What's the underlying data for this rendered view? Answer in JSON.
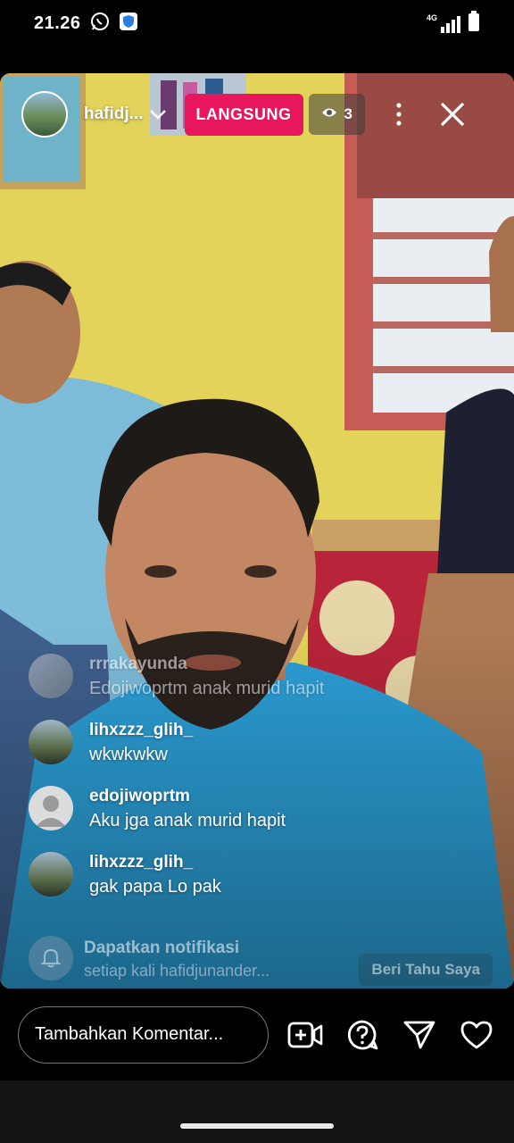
{
  "status_bar": {
    "time": "21.26",
    "network": "4G"
  },
  "live": {
    "username": "hafidj...",
    "live_label": "LANGSUNG",
    "viewer_count": "3"
  },
  "comments": [
    {
      "user": "rrrakayunda",
      "text": "Edojiwoprtm anak murid hapit"
    },
    {
      "user": "lihxzzz_glih_",
      "text": "wkwkwkw"
    },
    {
      "user": "edojiwoprtm",
      "text": "Aku jga anak murid hapit"
    },
    {
      "user": "lihxzzz_glih_",
      "text": "gak papa Lo pak"
    }
  ],
  "notification": {
    "title": "Dapatkan notifikasi",
    "subtitle": "setiap kali hafidjunander...",
    "button": "Beri Tahu Saya"
  },
  "bottom_bar": {
    "comment_placeholder": "Tambahkan Komentar...",
    "icons": [
      "add-video-icon",
      "question-icon",
      "send-icon",
      "heart-icon"
    ]
  },
  "colors": {
    "live_badge": "#e8175d",
    "background": "#000000"
  }
}
